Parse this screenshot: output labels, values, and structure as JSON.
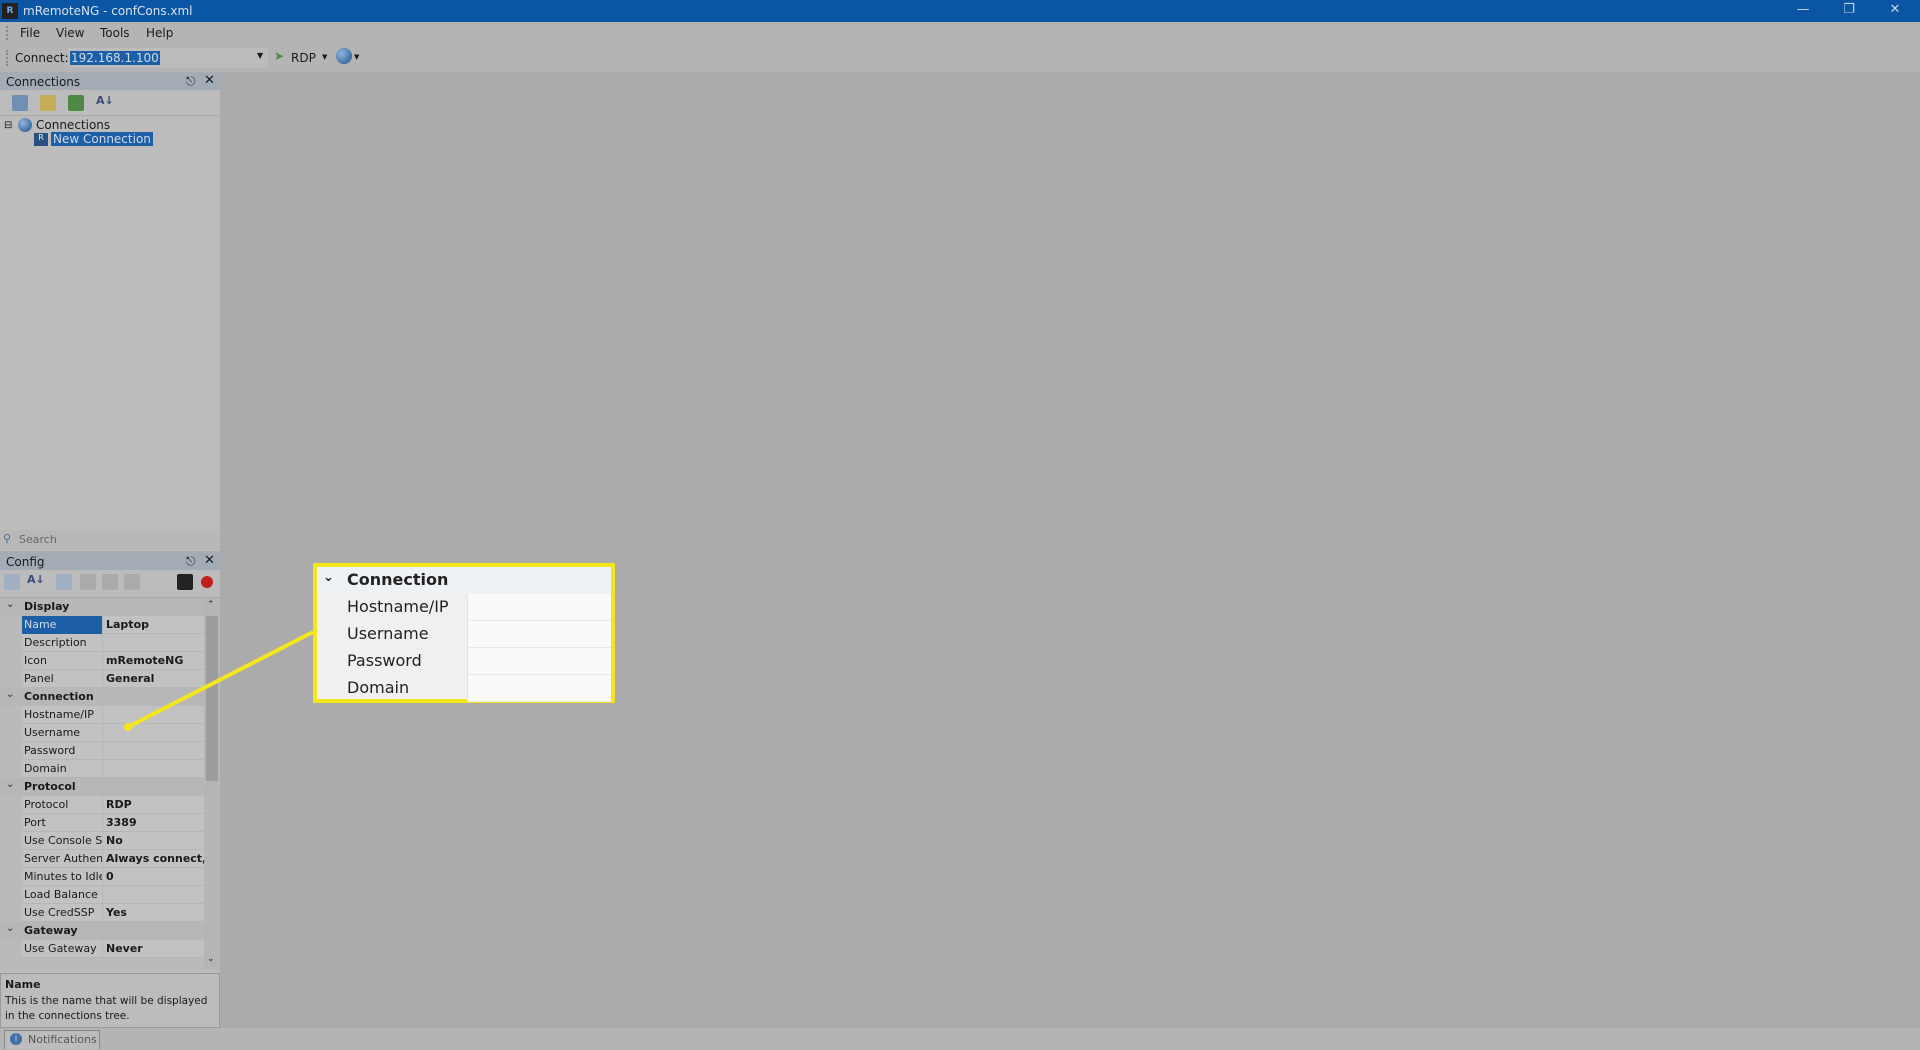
{
  "window": {
    "title": "mRemoteNG - confCons.xml",
    "logo_text": "R",
    "accent": "#0a56a5"
  },
  "menu": [
    "File",
    "View",
    "Tools",
    "Help"
  ],
  "toolbar": {
    "connect_label": "Connect:",
    "connect_value": "192.168.1.100",
    "protocol": "RDP"
  },
  "connections_panel": {
    "title": "Connections",
    "tree": {
      "root": "Connections",
      "child": "New Connection"
    },
    "search_placeholder": "Search"
  },
  "config_panel": {
    "title": "Config",
    "rows": [
      {
        "type": "cat",
        "label": "Display"
      },
      {
        "label": "Name",
        "value": "Laptop",
        "selected": true
      },
      {
        "label": "Description",
        "value": ""
      },
      {
        "label": "Icon",
        "value": "mRemoteNG"
      },
      {
        "label": "Panel",
        "value": "General"
      },
      {
        "type": "cat",
        "label": "Connection"
      },
      {
        "label": "Hostname/IP",
        "value": ""
      },
      {
        "label": "Username",
        "value": ""
      },
      {
        "label": "Password",
        "value": ""
      },
      {
        "label": "Domain",
        "value": ""
      },
      {
        "type": "cat",
        "label": "Protocol"
      },
      {
        "label": "Protocol",
        "value": "RDP"
      },
      {
        "label": "Port",
        "value": "3389"
      },
      {
        "label": "Use Console Se",
        "value": "No"
      },
      {
        "label": "Server Authenti",
        "value": "Always connect, ev"
      },
      {
        "label": "Minutes to Idle",
        "value": "0"
      },
      {
        "label": "Load Balance Ir",
        "value": ""
      },
      {
        "label": "Use CredSSP",
        "value": "Yes"
      },
      {
        "type": "cat",
        "label": "Gateway"
      },
      {
        "label": "Use Gateway",
        "value": "Never"
      }
    ],
    "description": {
      "title": "Name",
      "text": "This is the name that will be displayed in the connections tree."
    }
  },
  "status": {
    "notifications": "Notifications"
  },
  "callout": {
    "header": "Connection",
    "fields": [
      "Hostname/IP",
      "Username",
      "Password",
      "Domain"
    ],
    "color": "#f4e51c"
  }
}
